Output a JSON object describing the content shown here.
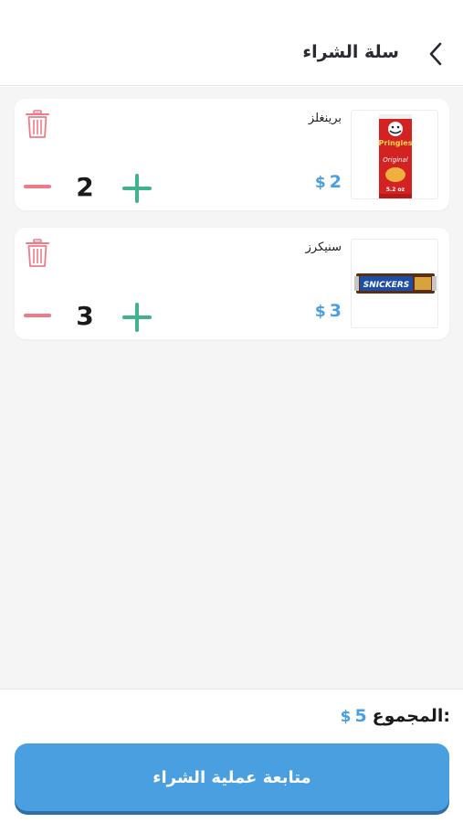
{
  "header": {
    "title": "سلة الشراء",
    "back_icon": "chevron-left-icon"
  },
  "cart": {
    "items": [
      {
        "name": "برينغلز",
        "price_currency": "$",
        "price_value": "2",
        "quantity": "2",
        "image": "pringles-can-image"
      },
      {
        "name": "سنيكرز",
        "price_currency": "$",
        "price_value": "3",
        "quantity": "3",
        "image": "snickers-bar-image"
      }
    ]
  },
  "summary": {
    "total_label": "المجموع:",
    "total_currency": "$",
    "total_value": "5"
  },
  "checkout": {
    "label": "متابعة عملية الشراء"
  },
  "colors": {
    "accent": "#4a9fe0",
    "minus": "#f07a88",
    "plus": "#3fb389",
    "trash": "#f07a88"
  },
  "product_art": {
    "pringles_brand": "Pringles",
    "pringles_flavor": "Original",
    "pringles_size": "5.2 oz",
    "snickers_brand": "SNICKERS"
  }
}
